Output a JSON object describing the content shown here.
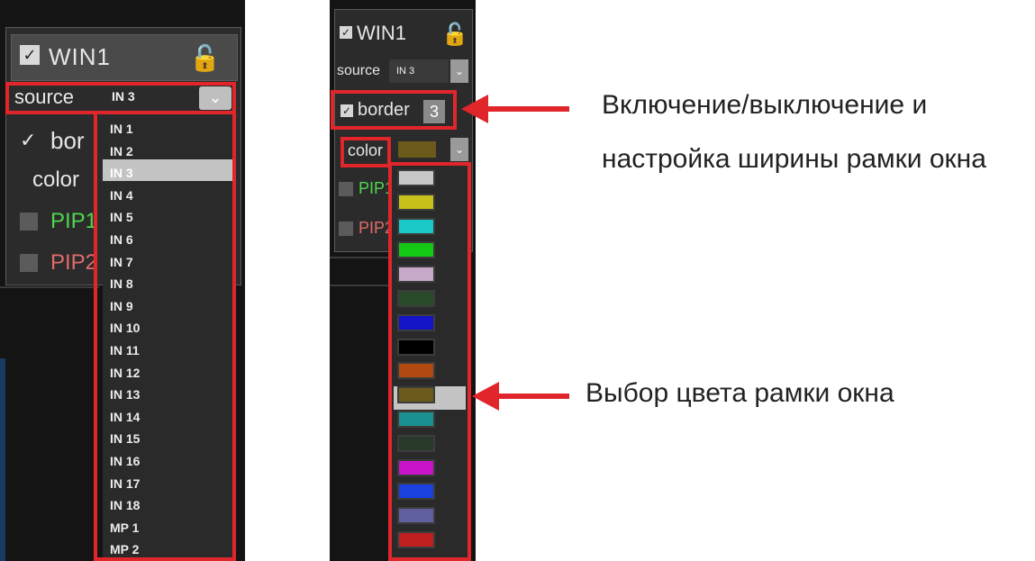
{
  "left_panel": {
    "window_title": "WIN1",
    "source_label": "source",
    "source_value": "IN 3",
    "border_label": "bor",
    "color_label": "color",
    "pip1_label": "PIP1",
    "pip2_label": "PIP2",
    "source_options": [
      "IN 1",
      "IN 2",
      "IN 3",
      "IN 4",
      "IN 5",
      "IN 6",
      "IN 7",
      "IN 8",
      "IN 9",
      "IN 10",
      "IN 11",
      "IN 12",
      "IN 13",
      "IN 14",
      "IN 15",
      "IN 16",
      "IN 17",
      "IN 18",
      "MP 1",
      "MP 2"
    ],
    "selected_option": "IN 3"
  },
  "right_panel": {
    "window_title": "WIN1",
    "source_label": "source",
    "source_value": "IN 3",
    "border_label": "border",
    "border_width": "3",
    "color_label": "color",
    "pip1_label": "PIP1",
    "pip2_label": "PIP2",
    "color_options": [
      "#c8c8c8",
      "#c8c01a",
      "#1ac8c8",
      "#14c814",
      "#c8a8c8",
      "#284a28",
      "#1414c8",
      "#000000",
      "#b04a10",
      "#6b5a1a",
      "#1a9090",
      "#2a3a2a",
      "#c814c8",
      "#1a40e0",
      "#6060a0",
      "#c02020"
    ],
    "selected_color": "#6b5a1a"
  },
  "annotations": {
    "border_note_line1": "Включение/выключение и",
    "border_note_line2": "настройка ширины рамки окна",
    "color_note": "Выбор цвета рамки окна"
  },
  "icons": {
    "check": "check-icon",
    "lock": "unlock-icon",
    "dropdown": "chevron-down-icon"
  },
  "accent_color": "#e0262b"
}
